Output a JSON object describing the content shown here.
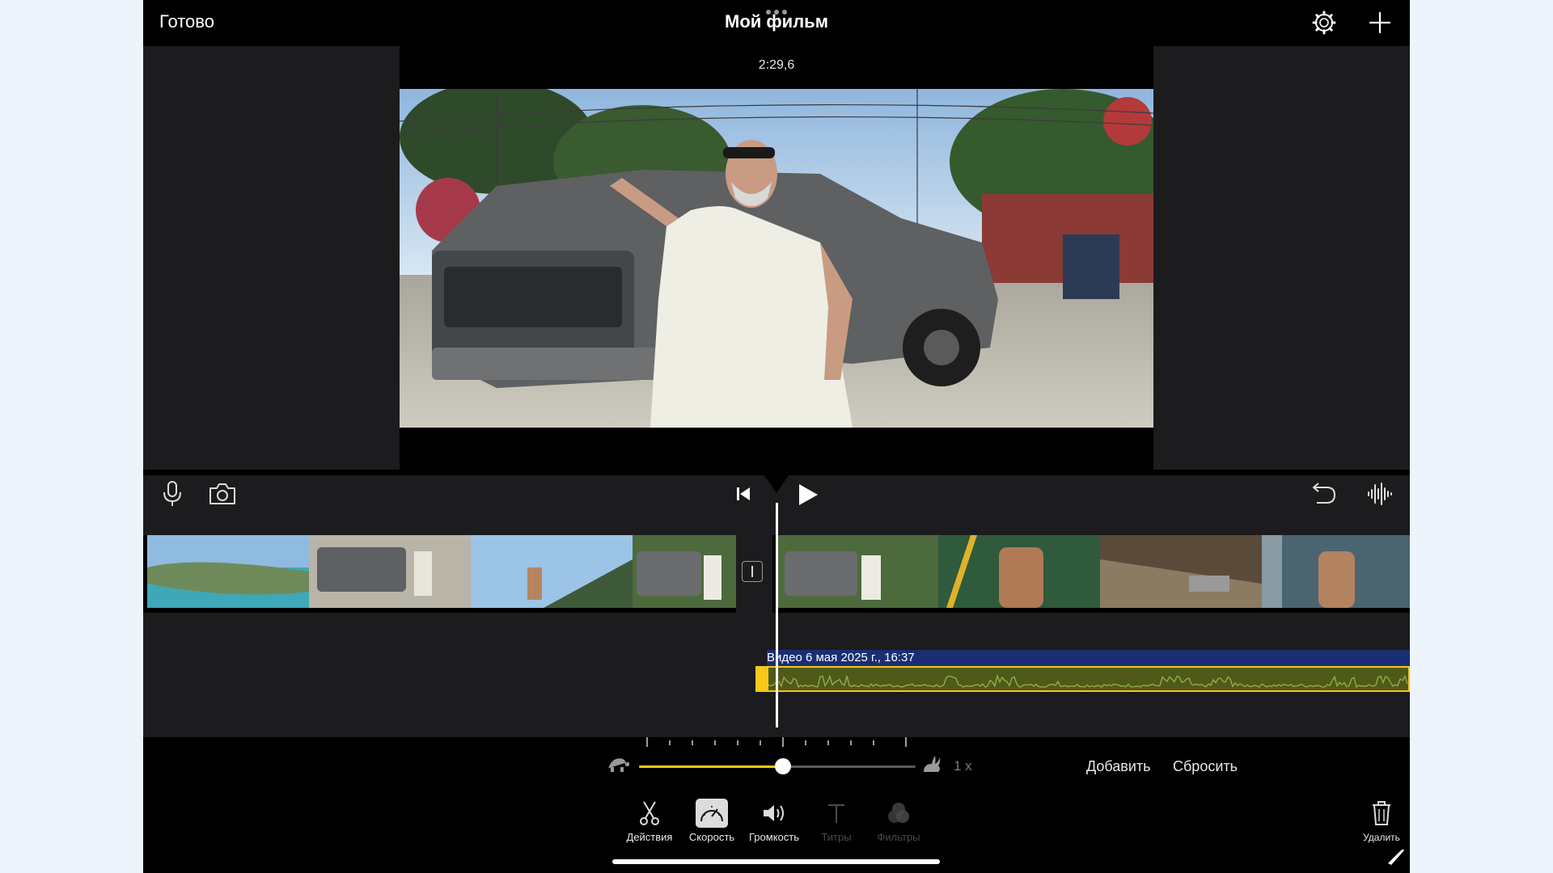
{
  "header": {
    "done_label": "Готово",
    "title": "Мой фильм"
  },
  "viewer": {
    "timecode": "2:29,6"
  },
  "timeline": {
    "audio_clip_label": "Видео 6 мая 2025 г., 16:37"
  },
  "speed": {
    "value_label": "1 x",
    "slider_level": 0.52,
    "add_label": "Добавить",
    "reset_label": "Сбросить"
  },
  "toolbar": {
    "tools": [
      {
        "label": "Действия",
        "icon": "scissors-icon",
        "state": "enabled"
      },
      {
        "label": "Скорость",
        "icon": "speedometer-icon",
        "state": "selected"
      },
      {
        "label": "Громкость",
        "icon": "speaker-icon",
        "state": "enabled"
      },
      {
        "label": "Титры",
        "icon": "text-icon",
        "state": "disabled"
      },
      {
        "label": "Фильтры",
        "icon": "filters-icon",
        "state": "disabled"
      }
    ],
    "delete_label": "Удалить"
  },
  "colors": {
    "accent": "#f4c81b",
    "background": "#000000",
    "panel": "#1c1c1e",
    "audio_label_bg": "#1a2f73",
    "audio_wave": "#8fae4a"
  }
}
